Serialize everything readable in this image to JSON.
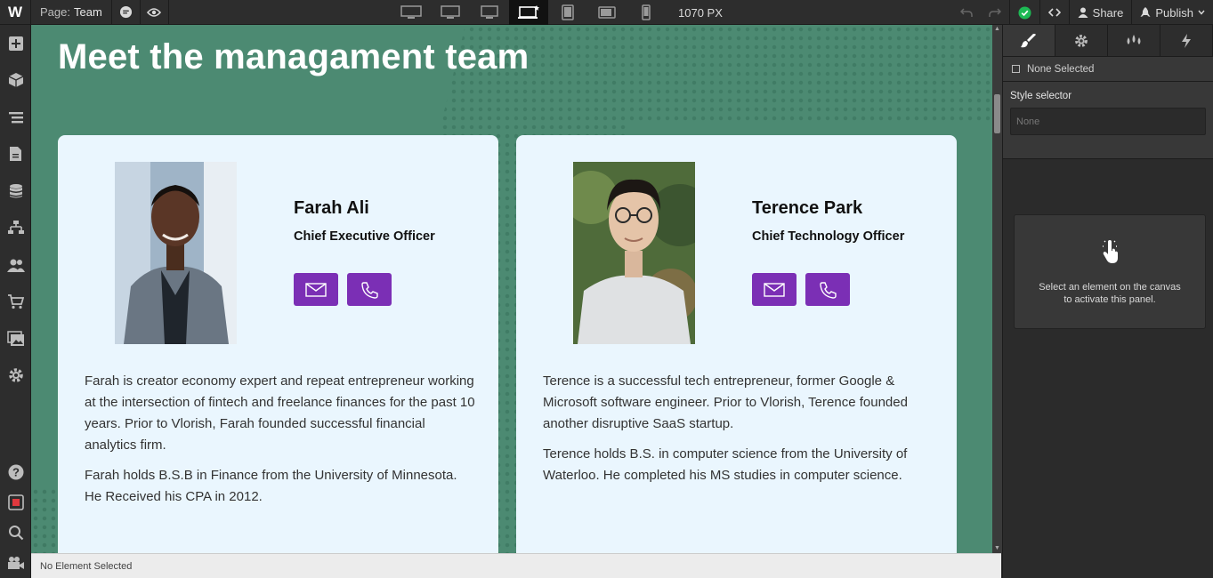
{
  "topbar": {
    "logo": "W",
    "page_label": "Page:",
    "page_name": "Team",
    "width_value": "1070",
    "width_unit": "PX",
    "share_label": "Share",
    "publish_label": "Publish"
  },
  "canvas": {
    "headline": "Meet the managament team",
    "members": [
      {
        "name": "Farah Ali",
        "title": "Chief Executive Officer",
        "bio": [
          "Farah is creator economy expert and repeat entrepreneur working at the intersection of fintech and freelance finances for the past 10 years. Prior to Vlorish, Farah founded successful financial analytics firm.",
          "Farah holds B.S.B in Finance from the University of Minnesota. He Received his CPA in 2012."
        ]
      },
      {
        "name": "Terence Park",
        "title": "Chief Technology Officer",
        "bio": [
          "Terence is a successful tech entrepreneur, former Google & Microsoft software engineer. Prior to Vlorish, Terence founded another disruptive SaaS startup.",
          "Terence holds B.S. in computer science from the University of Waterloo. He completed his MS studies in computer science."
        ]
      }
    ]
  },
  "status": {
    "text": "No Element Selected"
  },
  "right_panel": {
    "none_selected": "None Selected",
    "style_selector_label": "Style selector",
    "style_selector_placeholder": "None",
    "hint_line1": "Select an element on the canvas",
    "hint_line2": "to activate this panel."
  },
  "colors": {
    "canvas_bg": "#4c8a72",
    "card_bg": "#eaf6fe",
    "accent": "#7b2fb5",
    "check_green": "#1db954"
  }
}
